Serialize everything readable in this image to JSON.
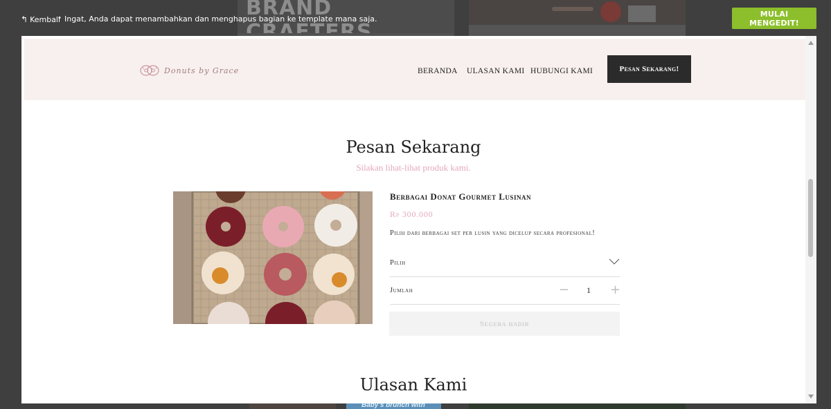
{
  "background": {
    "thumb_text": "BRAND CRAFTERS",
    "bottom_thumb_text": "Baby's brunch with"
  },
  "topbar": {
    "back_label": "Kembali",
    "separator": "•",
    "note": "Ingat, Anda dapat menambahkan dan menghapus bagian ke template mana saja.",
    "start_button": "MULAI MENGEDIT!",
    "start_button_color": "#8cbf2b"
  },
  "site": {
    "logo_text": "Donuts by Grace",
    "nav": [
      "BERANDA",
      "ULASAN KAMI",
      "HUBUNGI KAMI"
    ],
    "cta": "Pesan Sekarang!",
    "header_bg": "#f8f0ef"
  },
  "order": {
    "title": "Pesan Sekarang",
    "subtitle": "Silakan lihat-lihat produk kami.",
    "product": {
      "name": "Berbagai Donat Gourmet Lusinan",
      "price": "Rp 300.000",
      "description": "Pilih dari berbagai set per lusin yang dicelup secara profesional!",
      "select_label": "Pilih",
      "qty_label": "Jumlah",
      "qty_minus": "−",
      "qty_value": "1",
      "qty_plus": "+",
      "button": "Segera hadir"
    },
    "accent_color": "#e4a9ba"
  },
  "reviews": {
    "title": "Ulasan Kami"
  }
}
